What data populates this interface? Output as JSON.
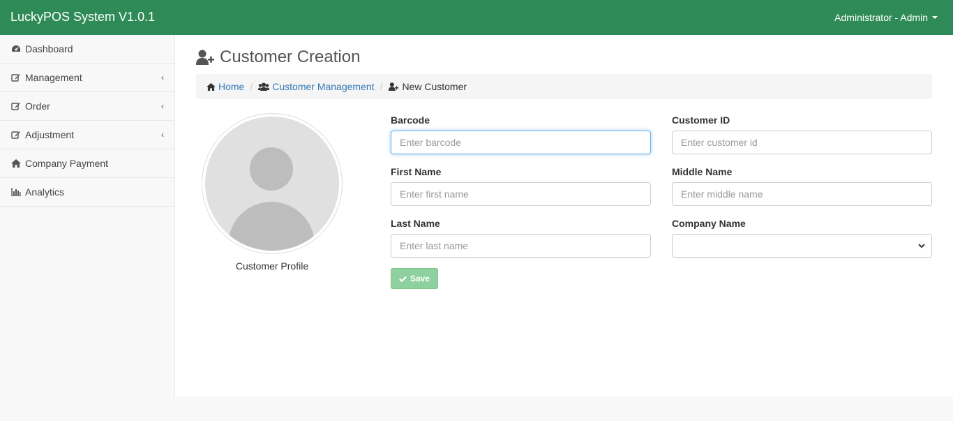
{
  "app": {
    "brand": "LuckyPOS System V1.0.1",
    "user_label": "Administrator - Admin"
  },
  "sidebar": {
    "items": [
      {
        "label": "Dashboard",
        "icon": "dashboard-icon",
        "has_children": false
      },
      {
        "label": "Management",
        "icon": "edit-icon",
        "has_children": true
      },
      {
        "label": "Order",
        "icon": "edit-icon",
        "has_children": true
      },
      {
        "label": "Adjustment",
        "icon": "edit-icon",
        "has_children": true
      },
      {
        "label": "Company Payment",
        "icon": "home-icon",
        "has_children": false
      },
      {
        "label": "Analytics",
        "icon": "bar-chart-icon",
        "has_children": false
      }
    ]
  },
  "page": {
    "title": "Customer Creation"
  },
  "breadcrumb": {
    "home": "Home",
    "customer_management": "Customer Management",
    "current": "New Customer"
  },
  "profile": {
    "caption": "Customer Profile"
  },
  "form": {
    "barcode": {
      "label": "Barcode",
      "placeholder": "Enter barcode"
    },
    "customer_id": {
      "label": "Customer ID",
      "placeholder": "Enter customer id"
    },
    "first_name": {
      "label": "First Name",
      "placeholder": "Enter first name"
    },
    "middle_name": {
      "label": "Middle Name",
      "placeholder": "Enter middle name"
    },
    "last_name": {
      "label": "Last Name",
      "placeholder": "Enter last name"
    },
    "company_name": {
      "label": "Company Name",
      "value": ""
    },
    "save_label": "Save"
  },
  "colors": {
    "topbar": "#2e8b57",
    "link": "#337ab7",
    "save_button": "#8fd19e"
  }
}
